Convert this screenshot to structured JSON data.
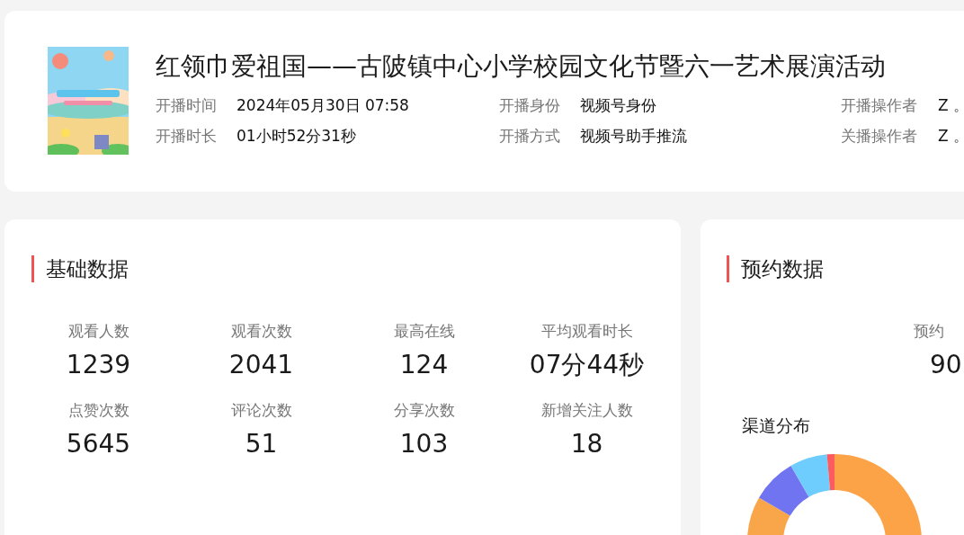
{
  "live": {
    "title": "红领巾爱祖国——古陂镇中心小学校园文化节暨六一艺术展演活动",
    "info": [
      {
        "label": "开播时间",
        "value": "2024年05月30日 07:58"
      },
      {
        "label": "开播身份",
        "value": "视频号身份"
      },
      {
        "label": "开播操作者",
        "value": "Z 。"
      },
      {
        "label": "开播时长",
        "value": "01小时52分31秒"
      },
      {
        "label": "开播方式",
        "value": "视频号助手推流"
      },
      {
        "label": "关播操作者",
        "value": "Z 。"
      }
    ]
  },
  "basic": {
    "title": "基础数据",
    "stats": [
      {
        "label": "观看人数",
        "value": "1239"
      },
      {
        "label": "观看次数",
        "value": "2041"
      },
      {
        "label": "最高在线",
        "value": "124"
      },
      {
        "label": "平均观看时长",
        "value": "07分44秒"
      },
      {
        "label": "点赞次数",
        "value": "5645"
      },
      {
        "label": "评论次数",
        "value": "51"
      },
      {
        "label": "分享次数",
        "value": "103"
      },
      {
        "label": "新增关注人数",
        "value": "18"
      }
    ]
  },
  "reservation": {
    "title": "预约数据",
    "stat": {
      "label": "预约",
      "value": "90"
    },
    "channel_title": "渠道分布"
  }
}
